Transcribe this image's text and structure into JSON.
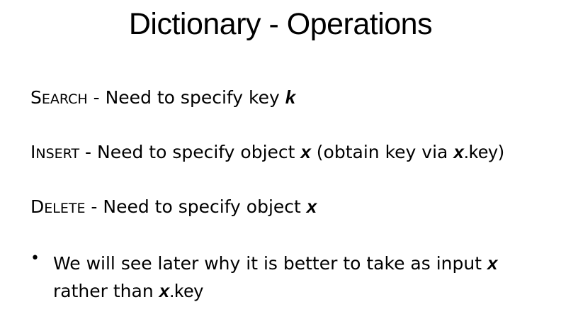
{
  "slide": {
    "title": "Dictionary - Operations",
    "search": {
      "op_first": "S",
      "op_rest": "earch",
      "text": " - Need to specify key ",
      "var": "k"
    },
    "insert": {
      "op_first": "I",
      "op_rest": "nsert",
      "text": " - Need to specify object ",
      "var": "x",
      "text2": " (obtain key via ",
      "var2": "x",
      "key2": ".key",
      "text3": ")"
    },
    "delete": {
      "op_first": "D",
      "op_rest": "elete",
      "text": " - Need to specify object ",
      "var": "x"
    },
    "bullet": {
      "dot": "•",
      "text1": "We will see later why it is better to take as input ",
      "var1": "x",
      "text2": "rather than ",
      "var2": "x",
      "key2": ".key"
    }
  }
}
